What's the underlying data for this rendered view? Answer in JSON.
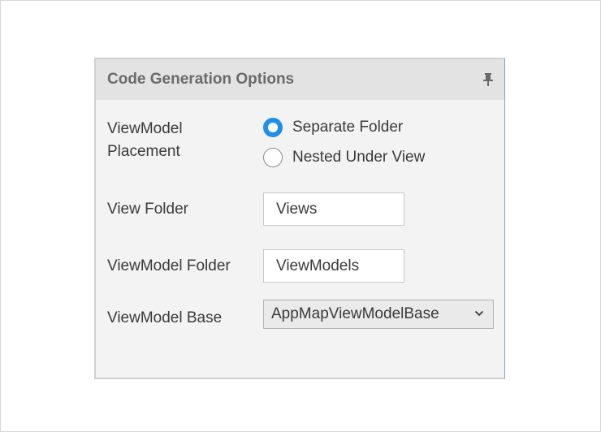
{
  "panel": {
    "title": "Code Generation Options",
    "pin_icon": "pin-icon"
  },
  "placement": {
    "label": "ViewModel\nPlacement",
    "options": [
      {
        "label": "Separate Folder",
        "checked": true
      },
      {
        "label": "Nested Under View",
        "checked": false
      }
    ]
  },
  "view_folder": {
    "label": "View Folder",
    "value": "Views"
  },
  "viewmodel_folder": {
    "label": "ViewModel Folder",
    "value": "ViewModels"
  },
  "viewmodel_base": {
    "label": "ViewModel Base",
    "selected": "AppMapViewModelBase",
    "dropdown_icon": "chevron-down-icon"
  },
  "colors": {
    "accent": "#1f8fea",
    "panel_bg": "#f3f3f3",
    "header_bg": "#e3e3e3"
  }
}
